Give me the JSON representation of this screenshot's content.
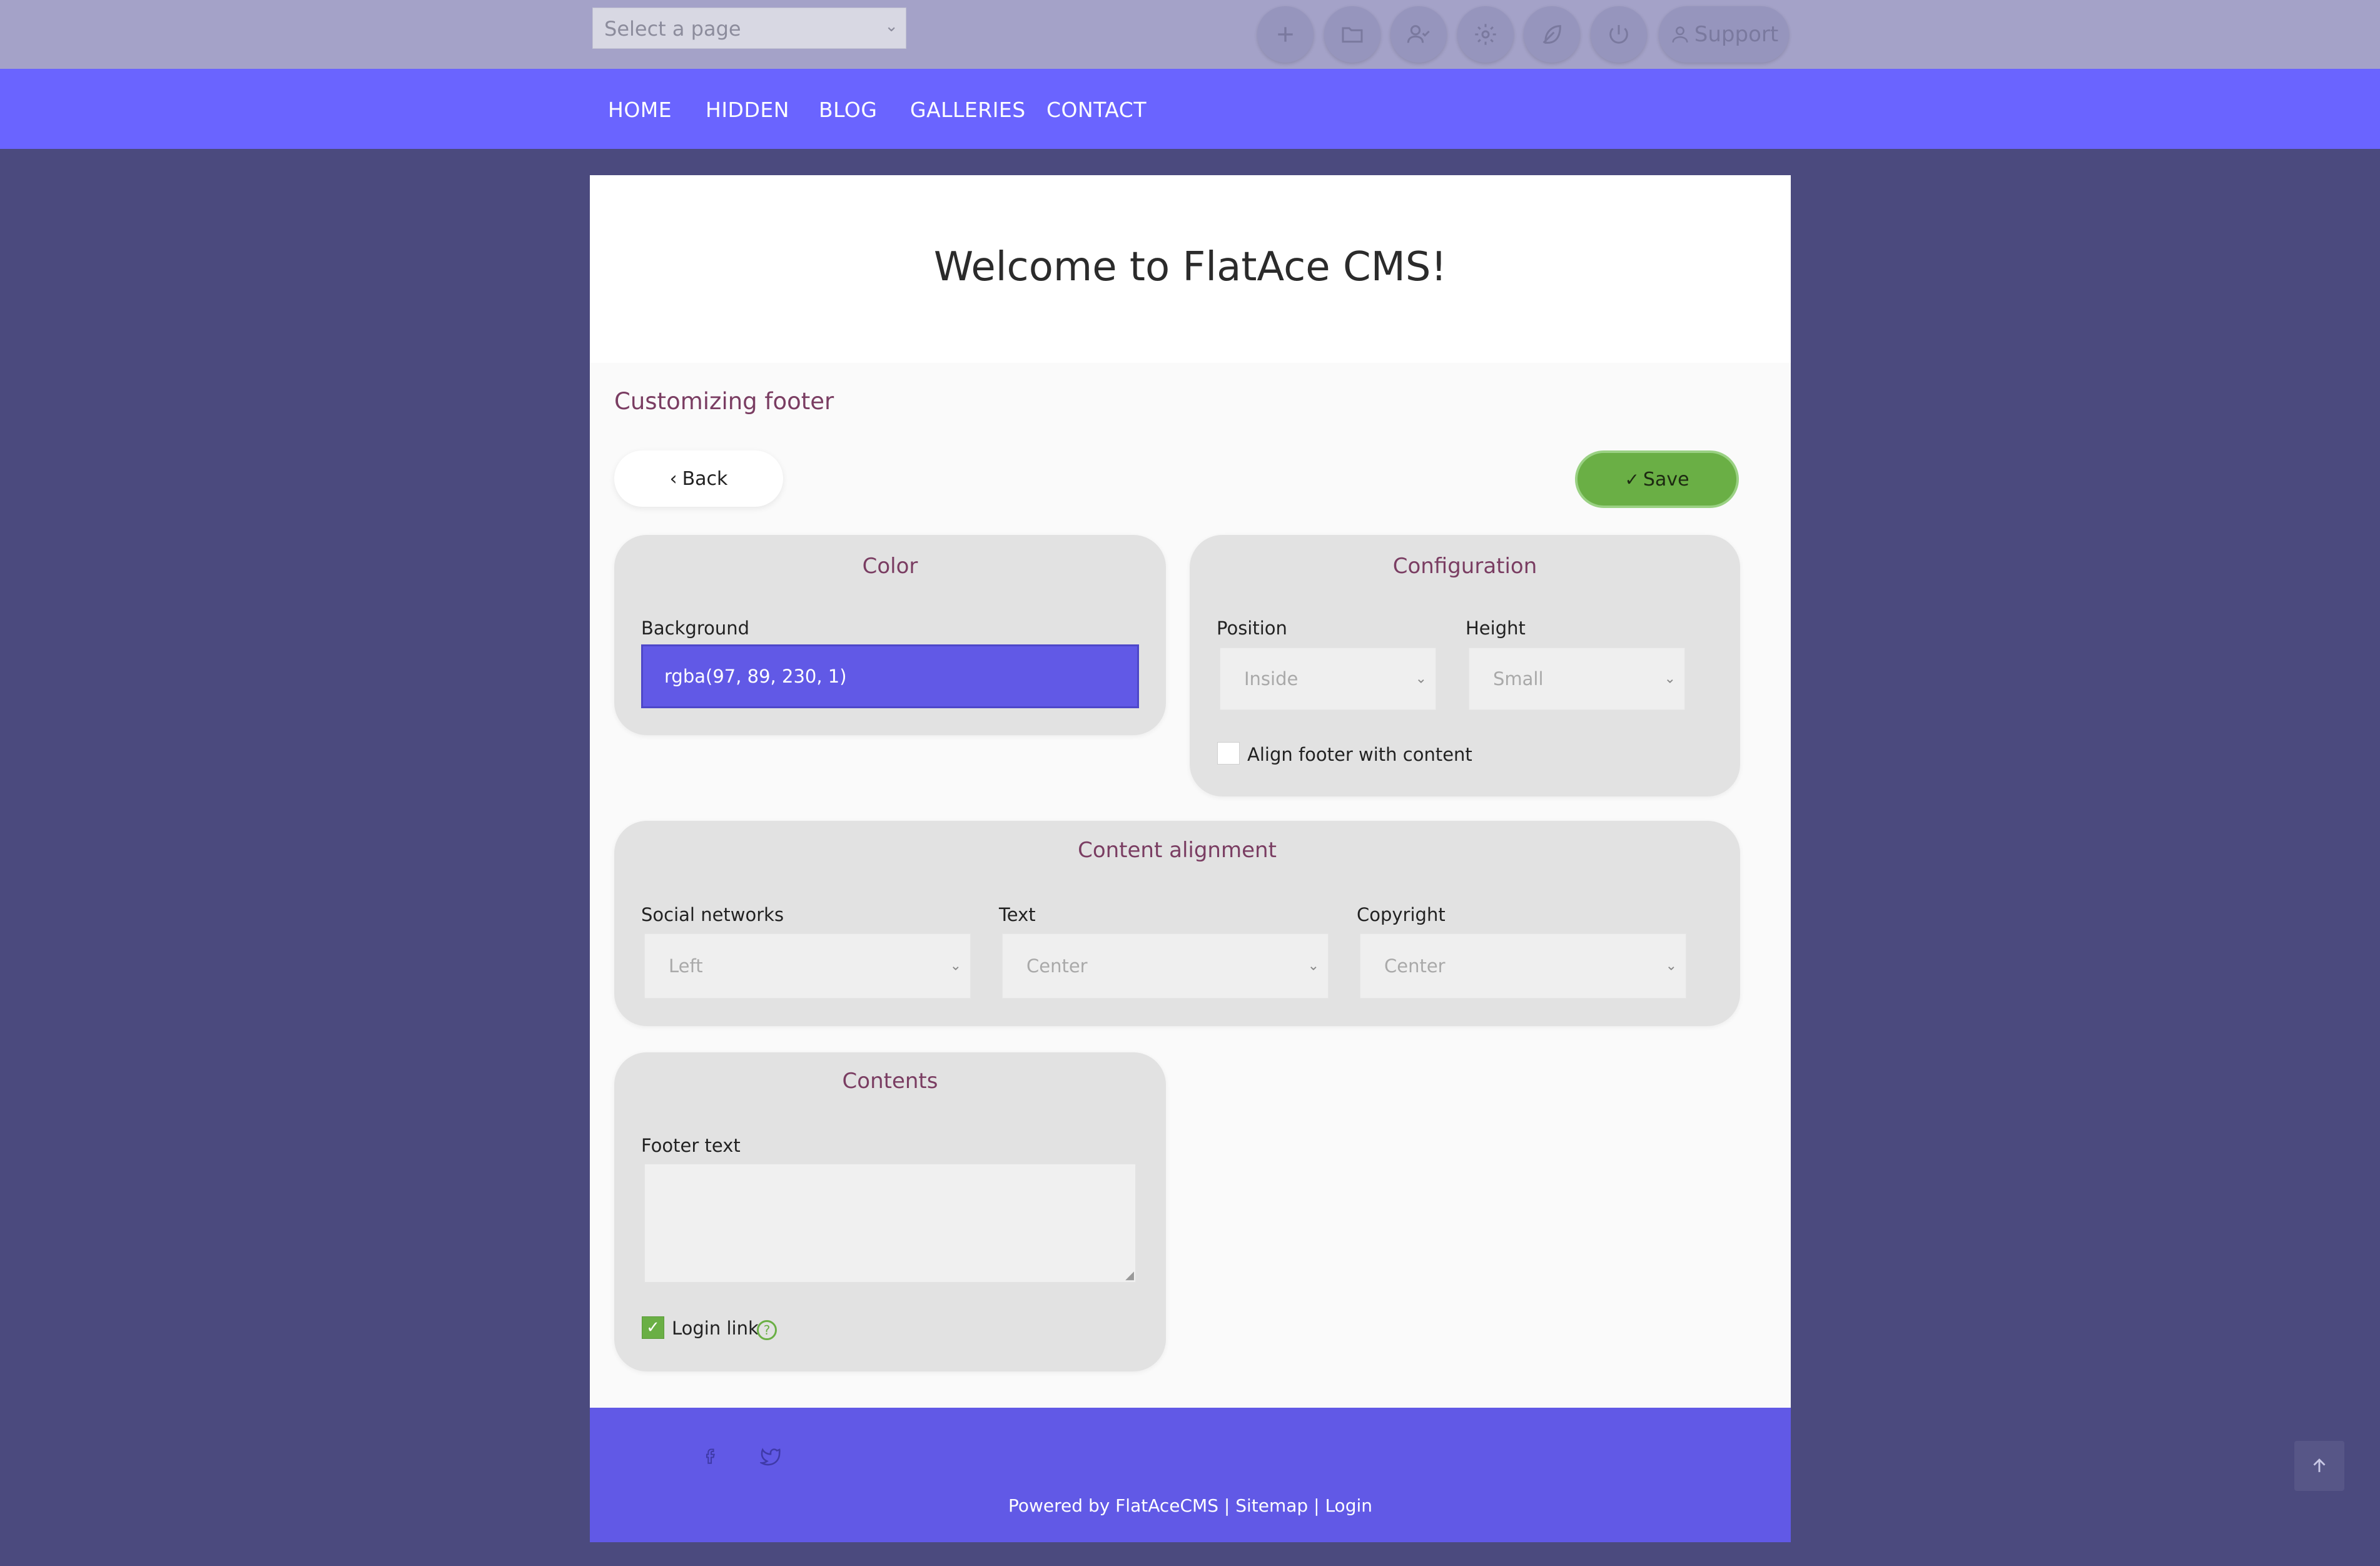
{
  "adminbar": {
    "page_select_placeholder": "Select a page",
    "buttons": [
      "plus-icon",
      "folder-icon",
      "user-check-icon",
      "gear-icon",
      "feather-icon",
      "power-icon"
    ],
    "support_label": "Support"
  },
  "nav": {
    "items": [
      "HOME",
      "HIDDEN",
      "BLOG",
      "GALLERIES",
      "CONTACT"
    ]
  },
  "header": {
    "welcome": "Welcome to FlatAce CMS!"
  },
  "page": {
    "title": "Customizing footer",
    "back_label": "Back",
    "save_label": "Save"
  },
  "color_panel": {
    "title": "Color",
    "background_label": "Background",
    "background_value": "rgba(97, 89, 230, 1)"
  },
  "config_panel": {
    "title": "Configuration",
    "position_label": "Position",
    "position_value": "Inside",
    "height_label": "Height",
    "height_value": "Small",
    "align_label": "Align footer with content",
    "align_checked": false
  },
  "alignment_panel": {
    "title": "Content alignment",
    "social_label": "Social networks",
    "social_value": "Left",
    "text_label": "Text",
    "text_value": "Center",
    "copyright_label": "Copyright",
    "copyright_value": "Center"
  },
  "contents_panel": {
    "title": "Contents",
    "footer_text_label": "Footer text",
    "footer_text_value": "",
    "login_link_label": "Login link",
    "login_link_checked": true,
    "help_glyph": "?"
  },
  "site_footer": {
    "powered": "Powered by FlatAceCMS",
    "sep1": "|",
    "sitemap": "Sitemap",
    "sep2": "|",
    "login": "Login"
  },
  "colors": {
    "nav": "#6a64ff",
    "footer_bg": "#6159e6",
    "accent_title": "#7a3d62",
    "save_green": "#6aaf45"
  }
}
